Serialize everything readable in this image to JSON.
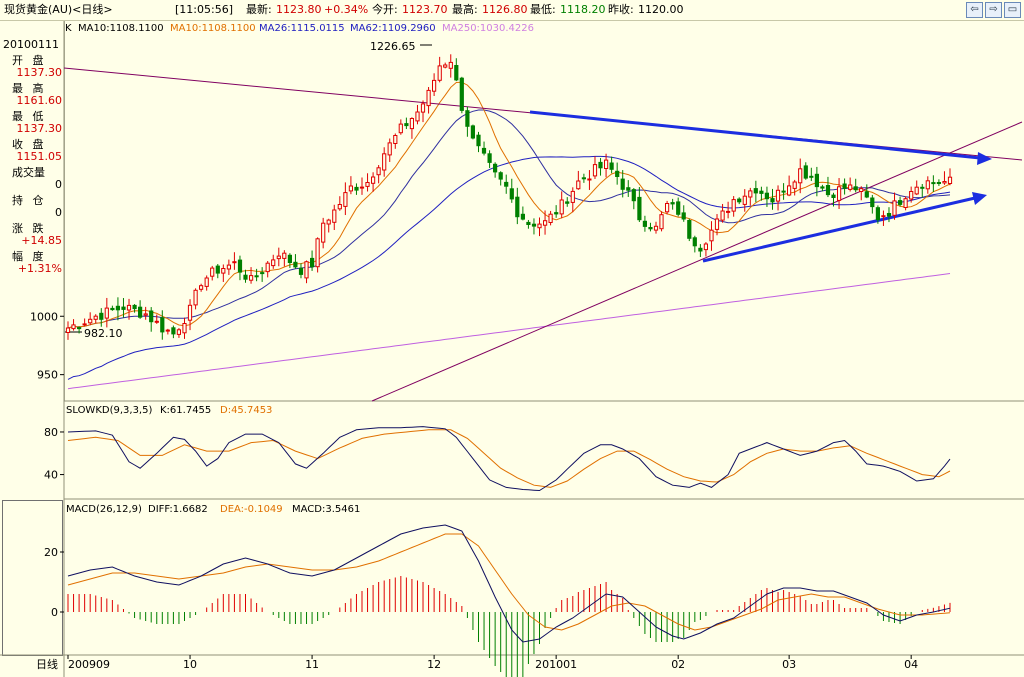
{
  "window": {
    "title": "现货黄金(AU)<日线>",
    "time": "[11:05:56]",
    "latest_label": "最新:",
    "latest": "1123.80",
    "change": "+0.34%",
    "open_label": "今开:",
    "open": "1123.70",
    "high_label": "最高:",
    "high": "1126.80",
    "low_label": "最低:",
    "low": "1118.20",
    "prev_label": "昨收:",
    "prev": "1120.00",
    "buttons": [
      "⇦",
      "⇨",
      "▭"
    ]
  },
  "sidebar": {
    "date": "20100111",
    "open_label": "开  盘",
    "open": "1137.30",
    "high_label": "最  高",
    "high": "1161.60",
    "low_label": "最  低",
    "low": "1137.30",
    "close_label": "收  盘",
    "close": "1151.05",
    "volume_label": "成交量",
    "volume": "0",
    "position_label": "持  仓",
    "position": "0",
    "change_label": "涨  跌",
    "change": "+14.85",
    "range_label": "幅  度",
    "range": "+1.31%"
  },
  "chart_data": [
    {
      "type": "candlestick",
      "legend": {
        "prefix": "K",
        "ma10_label": "MA10:1108.1100",
        "ma10b_label": "MA10:1108.1100",
        "ma26_label": "MA26:1115.0115",
        "ma62_label": "MA62:1109.2960",
        "ma250_label": "MA250:1030.4226"
      },
      "colors": {
        "up": "#e00000",
        "down": "#008000",
        "ma10": "#e07000",
        "ma26": "#2020c0",
        "ma62": "#c060e0",
        "trend": "#1c2ee0",
        "line": "#800060"
      },
      "ylim": [
        930,
        1240
      ],
      "yticks": [
        950,
        1000
      ],
      "ytick_labels": [
        "950",
        "1000"
      ],
      "annotations": {
        "max": "1226.65",
        "min": "982.10"
      },
      "x_labels": [
        "200909",
        "10",
        "11",
        "12",
        "201001",
        "02",
        "03",
        "04"
      ],
      "x_label_index": [
        0,
        22,
        44,
        66,
        88,
        110,
        130,
        152
      ],
      "n": 160,
      "anchors": [
        [
          0,
          990
        ],
        [
          5,
          1000
        ],
        [
          10,
          1008
        ],
        [
          14,
          1002
        ],
        [
          17,
          990
        ],
        [
          19,
          985
        ],
        [
          22,
          1005
        ],
        [
          24,
          1030
        ],
        [
          27,
          1040
        ],
        [
          30,
          1045
        ],
        [
          33,
          1030
        ],
        [
          35,
          1040
        ],
        [
          38,
          1055
        ],
        [
          42,
          1040
        ],
        [
          44,
          1045
        ],
        [
          46,
          1080
        ],
        [
          48,
          1090
        ],
        [
          51,
          1110
        ],
        [
          54,
          1115
        ],
        [
          57,
          1140
        ],
        [
          60,
          1160
        ],
        [
          63,
          1175
        ],
        [
          65,
          1190
        ],
        [
          67,
          1215
        ],
        [
          69,
          1220
        ],
        [
          71,
          1180
        ],
        [
          73,
          1150
        ],
        [
          75,
          1135
        ],
        [
          77,
          1120
        ],
        [
          79,
          1110
        ],
        [
          81,
          1090
        ],
        [
          83,
          1080
        ],
        [
          86,
          1080
        ],
        [
          89,
          1095
        ],
        [
          92,
          1115
        ],
        [
          95,
          1125
        ],
        [
          97,
          1130
        ],
        [
          99,
          1120
        ],
        [
          101,
          1105
        ],
        [
          103,
          1085
        ],
        [
          106,
          1075
        ],
        [
          108,
          1095
        ],
        [
          110,
          1090
        ],
        [
          112,
          1070
        ],
        [
          114,
          1060
        ],
        [
          117,
          1080
        ],
        [
          120,
          1100
        ],
        [
          122,
          1105
        ],
        [
          124,
          1110
        ],
        [
          127,
          1100
        ],
        [
          129,
          1110
        ],
        [
          132,
          1125
        ],
        [
          134,
          1120
        ],
        [
          137,
          1105
        ],
        [
          140,
          1110
        ],
        [
          142,
          1110
        ],
        [
          144,
          1100
        ],
        [
          146,
          1085
        ],
        [
          148,
          1090
        ],
        [
          150,
          1100
        ],
        [
          152,
          1110
        ],
        [
          154,
          1115
        ]
      ]
    },
    {
      "type": "line",
      "legend": {
        "name": "SLOWKD(9,3,3,5)",
        "k_label": "K:61.7455",
        "d_label": "D:45.7453"
      },
      "ylim": [
        18,
        95
      ],
      "yticks": [
        40,
        80
      ],
      "ytick_labels": [
        "40",
        "80"
      ],
      "k_anchors": [
        [
          0,
          80
        ],
        [
          5,
          81
        ],
        [
          8,
          77
        ],
        [
          11,
          52
        ],
        [
          13,
          46
        ],
        [
          16,
          60
        ],
        [
          19,
          75
        ],
        [
          21,
          73
        ],
        [
          23,
          62
        ],
        [
          25,
          48
        ],
        [
          27,
          55
        ],
        [
          29,
          70
        ],
        [
          32,
          78
        ],
        [
          35,
          78
        ],
        [
          38,
          70
        ],
        [
          41,
          50
        ],
        [
          43,
          46
        ],
        [
          46,
          60
        ],
        [
          49,
          75
        ],
        [
          52,
          82
        ],
        [
          56,
          84
        ],
        [
          60,
          84
        ],
        [
          64,
          85
        ],
        [
          68,
          83
        ],
        [
          70,
          75
        ],
        [
          73,
          55
        ],
        [
          76,
          35
        ],
        [
          79,
          28
        ],
        [
          82,
          26
        ],
        [
          85,
          25
        ],
        [
          88,
          35
        ],
        [
          91,
          50
        ],
        [
          93,
          60
        ],
        [
          96,
          68
        ],
        [
          98,
          68
        ],
        [
          100,
          64
        ],
        [
          103,
          55
        ],
        [
          106,
          38
        ],
        [
          109,
          30
        ],
        [
          112,
          28
        ],
        [
          114,
          32
        ],
        [
          116,
          28
        ],
        [
          119,
          40
        ],
        [
          121,
          60
        ],
        [
          124,
          66
        ],
        [
          126,
          70
        ],
        [
          129,
          64
        ],
        [
          132,
          58
        ],
        [
          135,
          62
        ],
        [
          138,
          70
        ],
        [
          140,
          72
        ],
        [
          142,
          62
        ],
        [
          144,
          50
        ],
        [
          147,
          48
        ],
        [
          150,
          43
        ],
        [
          153,
          34
        ],
        [
          156,
          36
        ],
        [
          158,
          48
        ],
        [
          160,
          61
        ]
      ],
      "d_anchors": [
        [
          0,
          72
        ],
        [
          5,
          75
        ],
        [
          9,
          72
        ],
        [
          13,
          58
        ],
        [
          17,
          58
        ],
        [
          21,
          68
        ],
        [
          25,
          62
        ],
        [
          29,
          62
        ],
        [
          33,
          70
        ],
        [
          37,
          72
        ],
        [
          41,
          62
        ],
        [
          45,
          55
        ],
        [
          49,
          65
        ],
        [
          53,
          74
        ],
        [
          57,
          78
        ],
        [
          61,
          80
        ],
        [
          65,
          82
        ],
        [
          69,
          82
        ],
        [
          72,
          74
        ],
        [
          75,
          60
        ],
        [
          78,
          46
        ],
        [
          81,
          37
        ],
        [
          84,
          30
        ],
        [
          87,
          28
        ],
        [
          90,
          34
        ],
        [
          93,
          45
        ],
        [
          96,
          55
        ],
        [
          99,
          62
        ],
        [
          102,
          62
        ],
        [
          105,
          54
        ],
        [
          108,
          45
        ],
        [
          111,
          38
        ],
        [
          114,
          34
        ],
        [
          117,
          33
        ],
        [
          120,
          40
        ],
        [
          123,
          52
        ],
        [
          126,
          60
        ],
        [
          129,
          64
        ],
        [
          132,
          62
        ],
        [
          135,
          62
        ],
        [
          138,
          65
        ],
        [
          141,
          67
        ],
        [
          144,
          60
        ],
        [
          147,
          54
        ],
        [
          151,
          46
        ],
        [
          154,
          40
        ],
        [
          157,
          38
        ],
        [
          160,
          46
        ]
      ]
    },
    {
      "type": "bar-line",
      "legend": {
        "name": "MACD(26,12,9)",
        "diff_label": "DIFF:1.6682",
        "dea_label": "DEA:-0.1049",
        "macd_label": "MACD:3.5461"
      },
      "ylim": [
        -14,
        32
      ],
      "yticks": [
        0,
        20
      ],
      "ytick_labels": [
        "0",
        "20"
      ],
      "diff_anchors": [
        [
          0,
          12
        ],
        [
          4,
          14
        ],
        [
          8,
          15
        ],
        [
          12,
          12
        ],
        [
          16,
          10
        ],
        [
          20,
          9
        ],
        [
          24,
          12
        ],
        [
          28,
          16
        ],
        [
          32,
          18
        ],
        [
          36,
          16
        ],
        [
          40,
          13
        ],
        [
          44,
          12
        ],
        [
          48,
          14
        ],
        [
          52,
          18
        ],
        [
          56,
          22
        ],
        [
          60,
          26
        ],
        [
          64,
          28
        ],
        [
          68,
          29
        ],
        [
          71,
          27
        ],
        [
          74,
          17
        ],
        [
          77,
          5
        ],
        [
          80,
          -6
        ],
        [
          82,
          -10
        ],
        [
          85,
          -9
        ],
        [
          88,
          -5
        ],
        [
          91,
          -2
        ],
        [
          94,
          2
        ],
        [
          97,
          6
        ],
        [
          100,
          5
        ],
        [
          103,
          0
        ],
        [
          106,
          -5
        ],
        [
          109,
          -8
        ],
        [
          111,
          -9
        ],
        [
          114,
          -7
        ],
        [
          117,
          -4
        ],
        [
          120,
          -2
        ],
        [
          123,
          2
        ],
        [
          126,
          6
        ],
        [
          129,
          8
        ],
        [
          132,
          8
        ],
        [
          135,
          7
        ],
        [
          138,
          7
        ],
        [
          141,
          5
        ],
        [
          144,
          3
        ],
        [
          147,
          -1
        ],
        [
          150,
          -3
        ],
        [
          153,
          -1
        ],
        [
          156,
          0
        ],
        [
          160,
          1.7
        ]
      ],
      "dea_anchors": [
        [
          0,
          9
        ],
        [
          4,
          11
        ],
        [
          8,
          13
        ],
        [
          12,
          13
        ],
        [
          16,
          12
        ],
        [
          20,
          11
        ],
        [
          24,
          12
        ],
        [
          28,
          13
        ],
        [
          32,
          15
        ],
        [
          36,
          16
        ],
        [
          40,
          15
        ],
        [
          44,
          14
        ],
        [
          48,
          14
        ],
        [
          52,
          15
        ],
        [
          56,
          17
        ],
        [
          60,
          20
        ],
        [
          64,
          23
        ],
        [
          68,
          26
        ],
        [
          71,
          26
        ],
        [
          74,
          22
        ],
        [
          77,
          14
        ],
        [
          80,
          6
        ],
        [
          83,
          -1
        ],
        [
          86,
          -5
        ],
        [
          89,
          -6
        ],
        [
          92,
          -4
        ],
        [
          95,
          -1
        ],
        [
          98,
          2
        ],
        [
          101,
          3
        ],
        [
          104,
          2
        ],
        [
          107,
          -1
        ],
        [
          110,
          -4
        ],
        [
          113,
          -6
        ],
        [
          116,
          -5
        ],
        [
          119,
          -3
        ],
        [
          122,
          -1
        ],
        [
          125,
          1
        ],
        [
          128,
          4
        ],
        [
          131,
          5
        ],
        [
          134,
          6
        ],
        [
          137,
          5
        ],
        [
          140,
          5
        ],
        [
          143,
          3
        ],
        [
          146,
          1
        ],
        [
          150,
          -1
        ],
        [
          154,
          -1
        ],
        [
          160,
          -0.1
        ]
      ]
    }
  ],
  "bottom": {
    "label": "日线"
  }
}
